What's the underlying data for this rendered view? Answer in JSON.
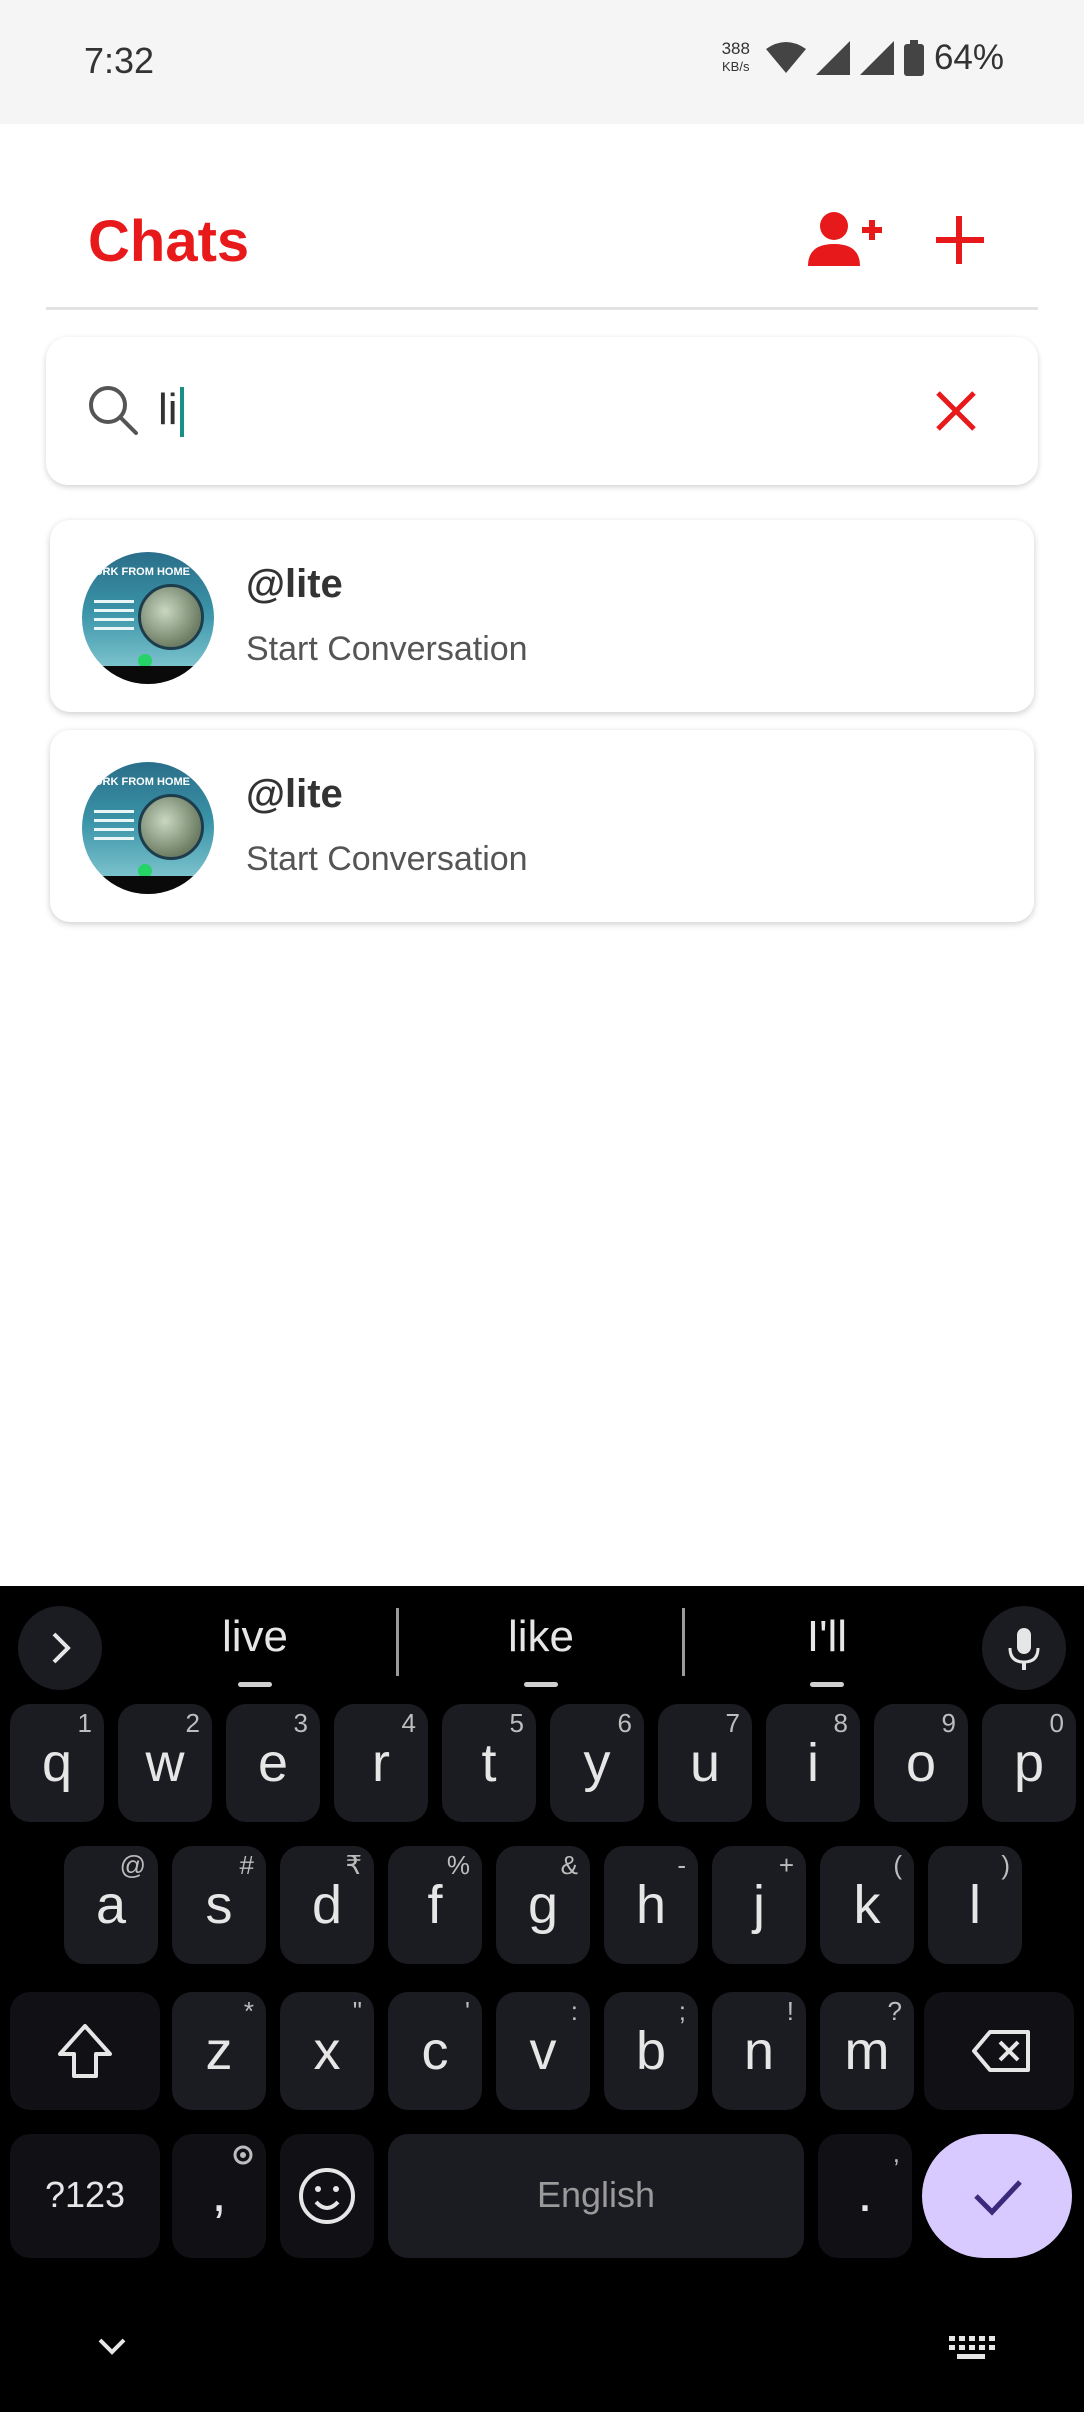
{
  "status_bar": {
    "time": "7:32",
    "speed_value": "388",
    "speed_unit": "KB/s",
    "battery": "64%"
  },
  "header": {
    "title": "Chats",
    "add_user_icon": "person-add-icon",
    "new_chat_icon": "plus-icon",
    "accent_color": "#e8191a"
  },
  "search": {
    "value": "li",
    "icon": "search-icon",
    "clear_icon": "close-icon"
  },
  "results": [
    {
      "name": "@lite",
      "subtitle": "Start Conversation",
      "avatar_text": "ORK FROM HOME"
    },
    {
      "name": "@lite",
      "subtitle": "Start Conversation",
      "avatar_text": "ORK FROM HOME"
    }
  ],
  "keyboard": {
    "suggestions": [
      "live",
      "like",
      "I'll"
    ],
    "row1": [
      {
        "k": "q",
        "h": "1"
      },
      {
        "k": "w",
        "h": "2"
      },
      {
        "k": "e",
        "h": "3"
      },
      {
        "k": "r",
        "h": "4"
      },
      {
        "k": "t",
        "h": "5"
      },
      {
        "k": "y",
        "h": "6"
      },
      {
        "k": "u",
        "h": "7"
      },
      {
        "k": "i",
        "h": "8"
      },
      {
        "k": "o",
        "h": "9"
      },
      {
        "k": "p",
        "h": "0"
      }
    ],
    "row2": [
      {
        "k": "a",
        "h": "@"
      },
      {
        "k": "s",
        "h": "#"
      },
      {
        "k": "d",
        "h": "₹"
      },
      {
        "k": "f",
        "h": "%"
      },
      {
        "k": "g",
        "h": "&"
      },
      {
        "k": "h",
        "h": "-"
      },
      {
        "k": "j",
        "h": "+"
      },
      {
        "k": "k",
        "h": "("
      },
      {
        "k": "l",
        "h": ")"
      }
    ],
    "row3": [
      {
        "k": "z",
        "h": "*"
      },
      {
        "k": "x",
        "h": "\""
      },
      {
        "k": "c",
        "h": "'"
      },
      {
        "k": "v",
        "h": ":"
      },
      {
        "k": "b",
        "h": ";"
      },
      {
        "k": "n",
        "h": "!"
      },
      {
        "k": "m",
        "h": "?"
      }
    ],
    "symbols_label": "?123",
    "comma": ",",
    "space_label": "English",
    "period": ".",
    "period_hint": ",",
    "enter_color": "#d8c9ff"
  }
}
